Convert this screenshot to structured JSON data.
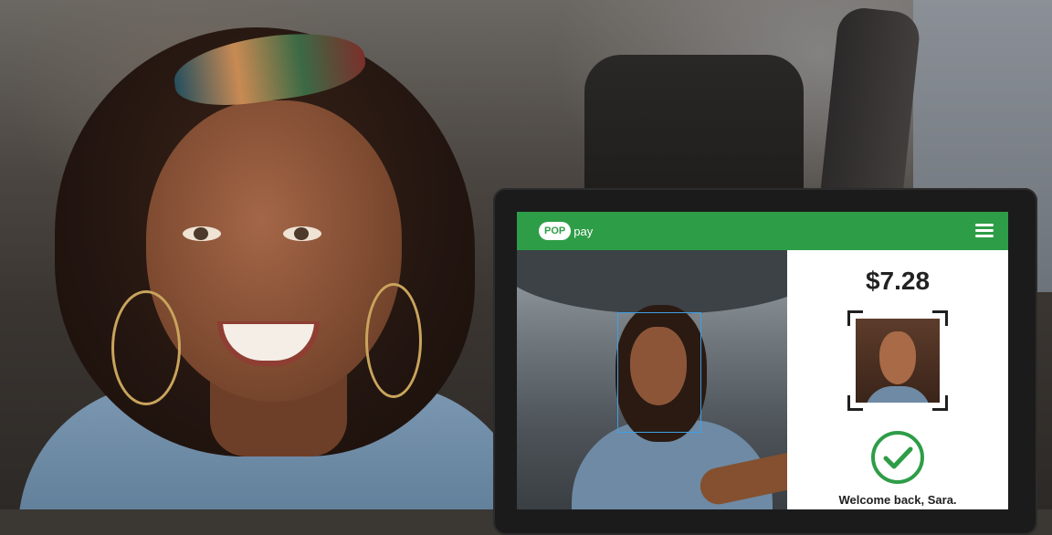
{
  "app": {
    "logo_pill": "POP",
    "logo_text": "pay"
  },
  "payment": {
    "amount": "$7.28",
    "message": "Welcome back, Sara."
  },
  "colors": {
    "brand_green": "#2e9d47",
    "face_box": "#3ea0e6",
    "check_green": "#2e9d47"
  },
  "icons": {
    "menu": "hamburger-menu-icon",
    "verified": "check-circle-icon"
  }
}
